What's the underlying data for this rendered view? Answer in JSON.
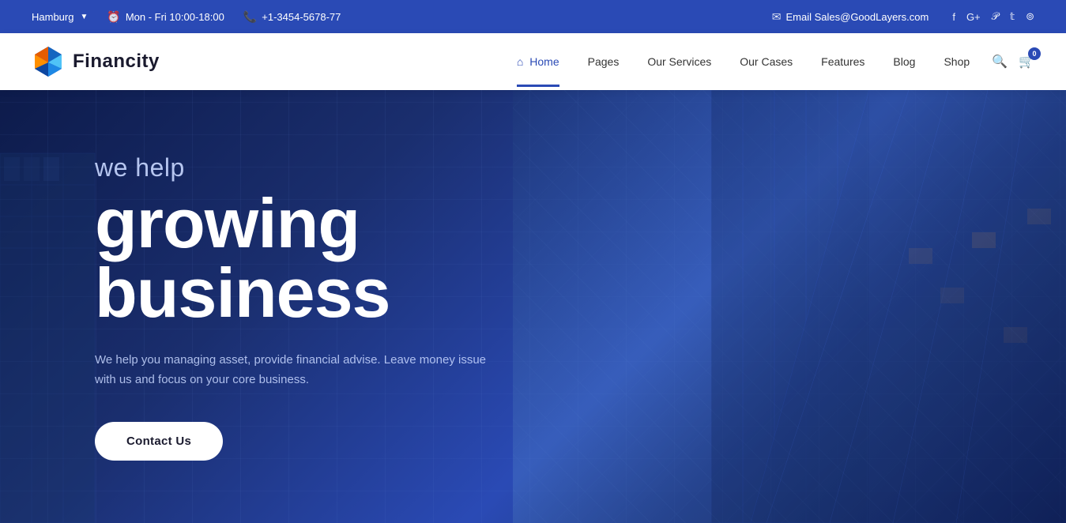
{
  "topbar": {
    "location": "Hamburg",
    "hours": "Mon - Fri 10:00-18:00",
    "phone": "+1-3454-5678-77",
    "email_label": "Email Sales@GoodLayers.com",
    "social": [
      "f",
      "G+",
      "P",
      "t",
      "ig"
    ]
  },
  "navbar": {
    "logo_text": "Financity",
    "links": [
      {
        "label": "Home",
        "active": true,
        "has_home_icon": true
      },
      {
        "label": "Pages",
        "active": false
      },
      {
        "label": "Our Services",
        "active": false
      },
      {
        "label": "Our Cases",
        "active": false
      },
      {
        "label": "Features",
        "active": false
      },
      {
        "label": "Blog",
        "active": false
      },
      {
        "label": "Shop",
        "active": false
      }
    ],
    "cart_count": "0"
  },
  "hero": {
    "subtitle": "we help",
    "title": "growing business",
    "description": "We help you managing asset, provide financial advise. Leave money issue with us and focus on your core business.",
    "cta_label": "Contact Us"
  },
  "colors": {
    "brand_blue": "#2a4ab5",
    "dark_navy": "#0d1b4b",
    "white": "#ffffff"
  }
}
